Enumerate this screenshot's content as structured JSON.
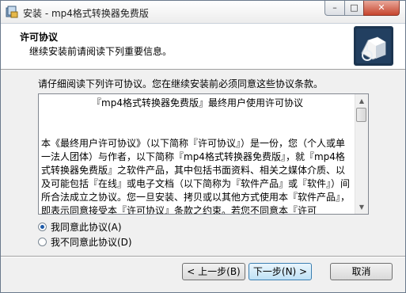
{
  "window": {
    "title": "安装 - mp4格式转换器免费版",
    "min_glyph": "–",
    "max_glyph": "□",
    "close_glyph": "✕"
  },
  "header": {
    "title": "许可协议",
    "subtitle": "继续安装前请阅读下列重要信息。"
  },
  "main": {
    "intro": "请仔细阅读下列许可协议。您在继续安装前必须同意这些协议条款。",
    "license": {
      "heading": "『mp4格式转换器免费版』最终用户使用许可协议",
      "body": "本《最终用户许可协议》（以下简称『许可协议』）是一份，您（个人或单一法人团体）与作者，以下简称『mp4格式转换器免费版』，就『mp4格式转换器免费版』之软件产品，其中包括书面资料、相关之媒体介质、以及可能包括『在线』或电子文档（以下简称为『软件产品』或『软件』）间所合法成立之协议。您一旦安装、拷贝或以其他方式使用本『软件产品』，即表示同意接受本『许可协议』条款之约束。若您不同意本『许可"
    },
    "options": {
      "accept_label": "我同意此协议(A)",
      "decline_label": "我不同意此协议(D)",
      "selected": "accept"
    }
  },
  "footer": {
    "back_label": "< 上一步(B)",
    "next_label": "下一步(N) >",
    "cancel_label": "取消"
  },
  "colors": {
    "accent": "#1d5aa8",
    "close_button": "#c6442d"
  }
}
